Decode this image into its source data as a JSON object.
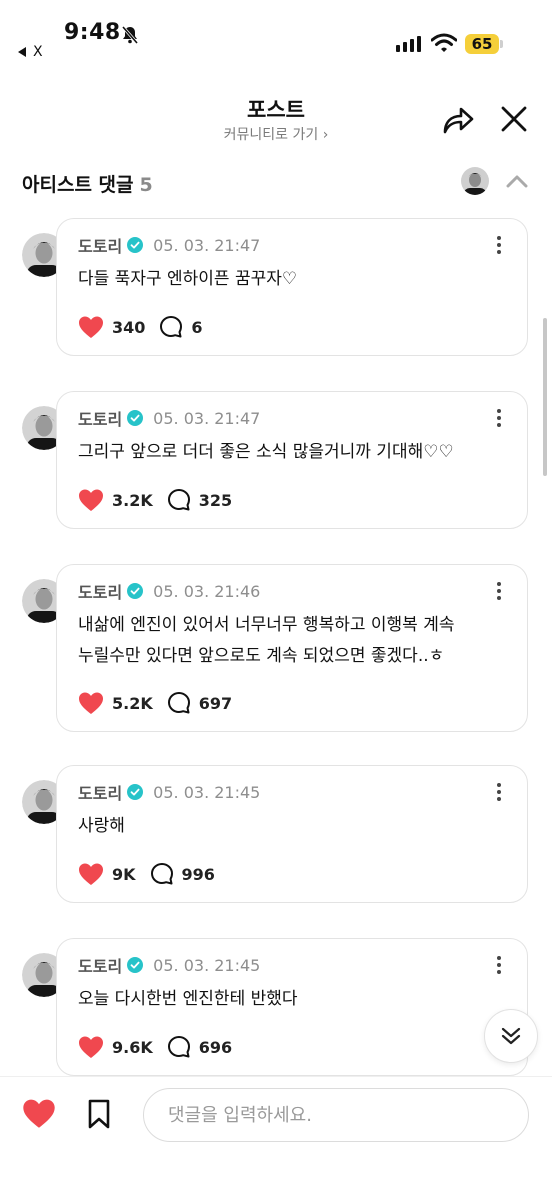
{
  "status_bar": {
    "time": "9:48",
    "back_app": "X",
    "battery": "65"
  },
  "header": {
    "title": "포스트",
    "community_link": "커뮤니티로 가기 ›"
  },
  "section": {
    "title": "아티스트 댓글",
    "count": "5"
  },
  "comments": [
    {
      "author": "도토리",
      "date": "05. 03. 21:47",
      "lines": [
        "다들 푹자구 엔하이픈 꿈꾸자♡"
      ],
      "likes": "340",
      "replies": "6"
    },
    {
      "author": "도토리",
      "date": "05. 03. 21:47",
      "lines": [
        "그리구 앞으로 더더 좋은 소식 많을거니까 기대해♡♡"
      ],
      "likes": "3.2K",
      "replies": "325"
    },
    {
      "author": "도토리",
      "date": "05. 03. 21:46",
      "lines": [
        "내삶에 엔진이 있어서 너무너무 행복하고 이행복 계속",
        "누릴수만 있다면 앞으로도 계속 되었으면 좋겠다..ㅎ"
      ],
      "likes": "5.2K",
      "replies": "697"
    },
    {
      "author": "도토리",
      "date": "05. 03. 21:45",
      "lines": [
        "사랑해"
      ],
      "likes": "9K",
      "replies": "996"
    },
    {
      "author": "도토리",
      "date": "05. 03. 21:45",
      "lines": [
        "오늘 다시한번 엔진한테 반했다"
      ],
      "likes": "9.6K",
      "replies": "696"
    }
  ],
  "input": {
    "placeholder": "댓글을 입력하세요."
  },
  "colors": {
    "heart": "#f0484f",
    "verified": "#27c3c9",
    "battery": "#f5cf3a"
  }
}
